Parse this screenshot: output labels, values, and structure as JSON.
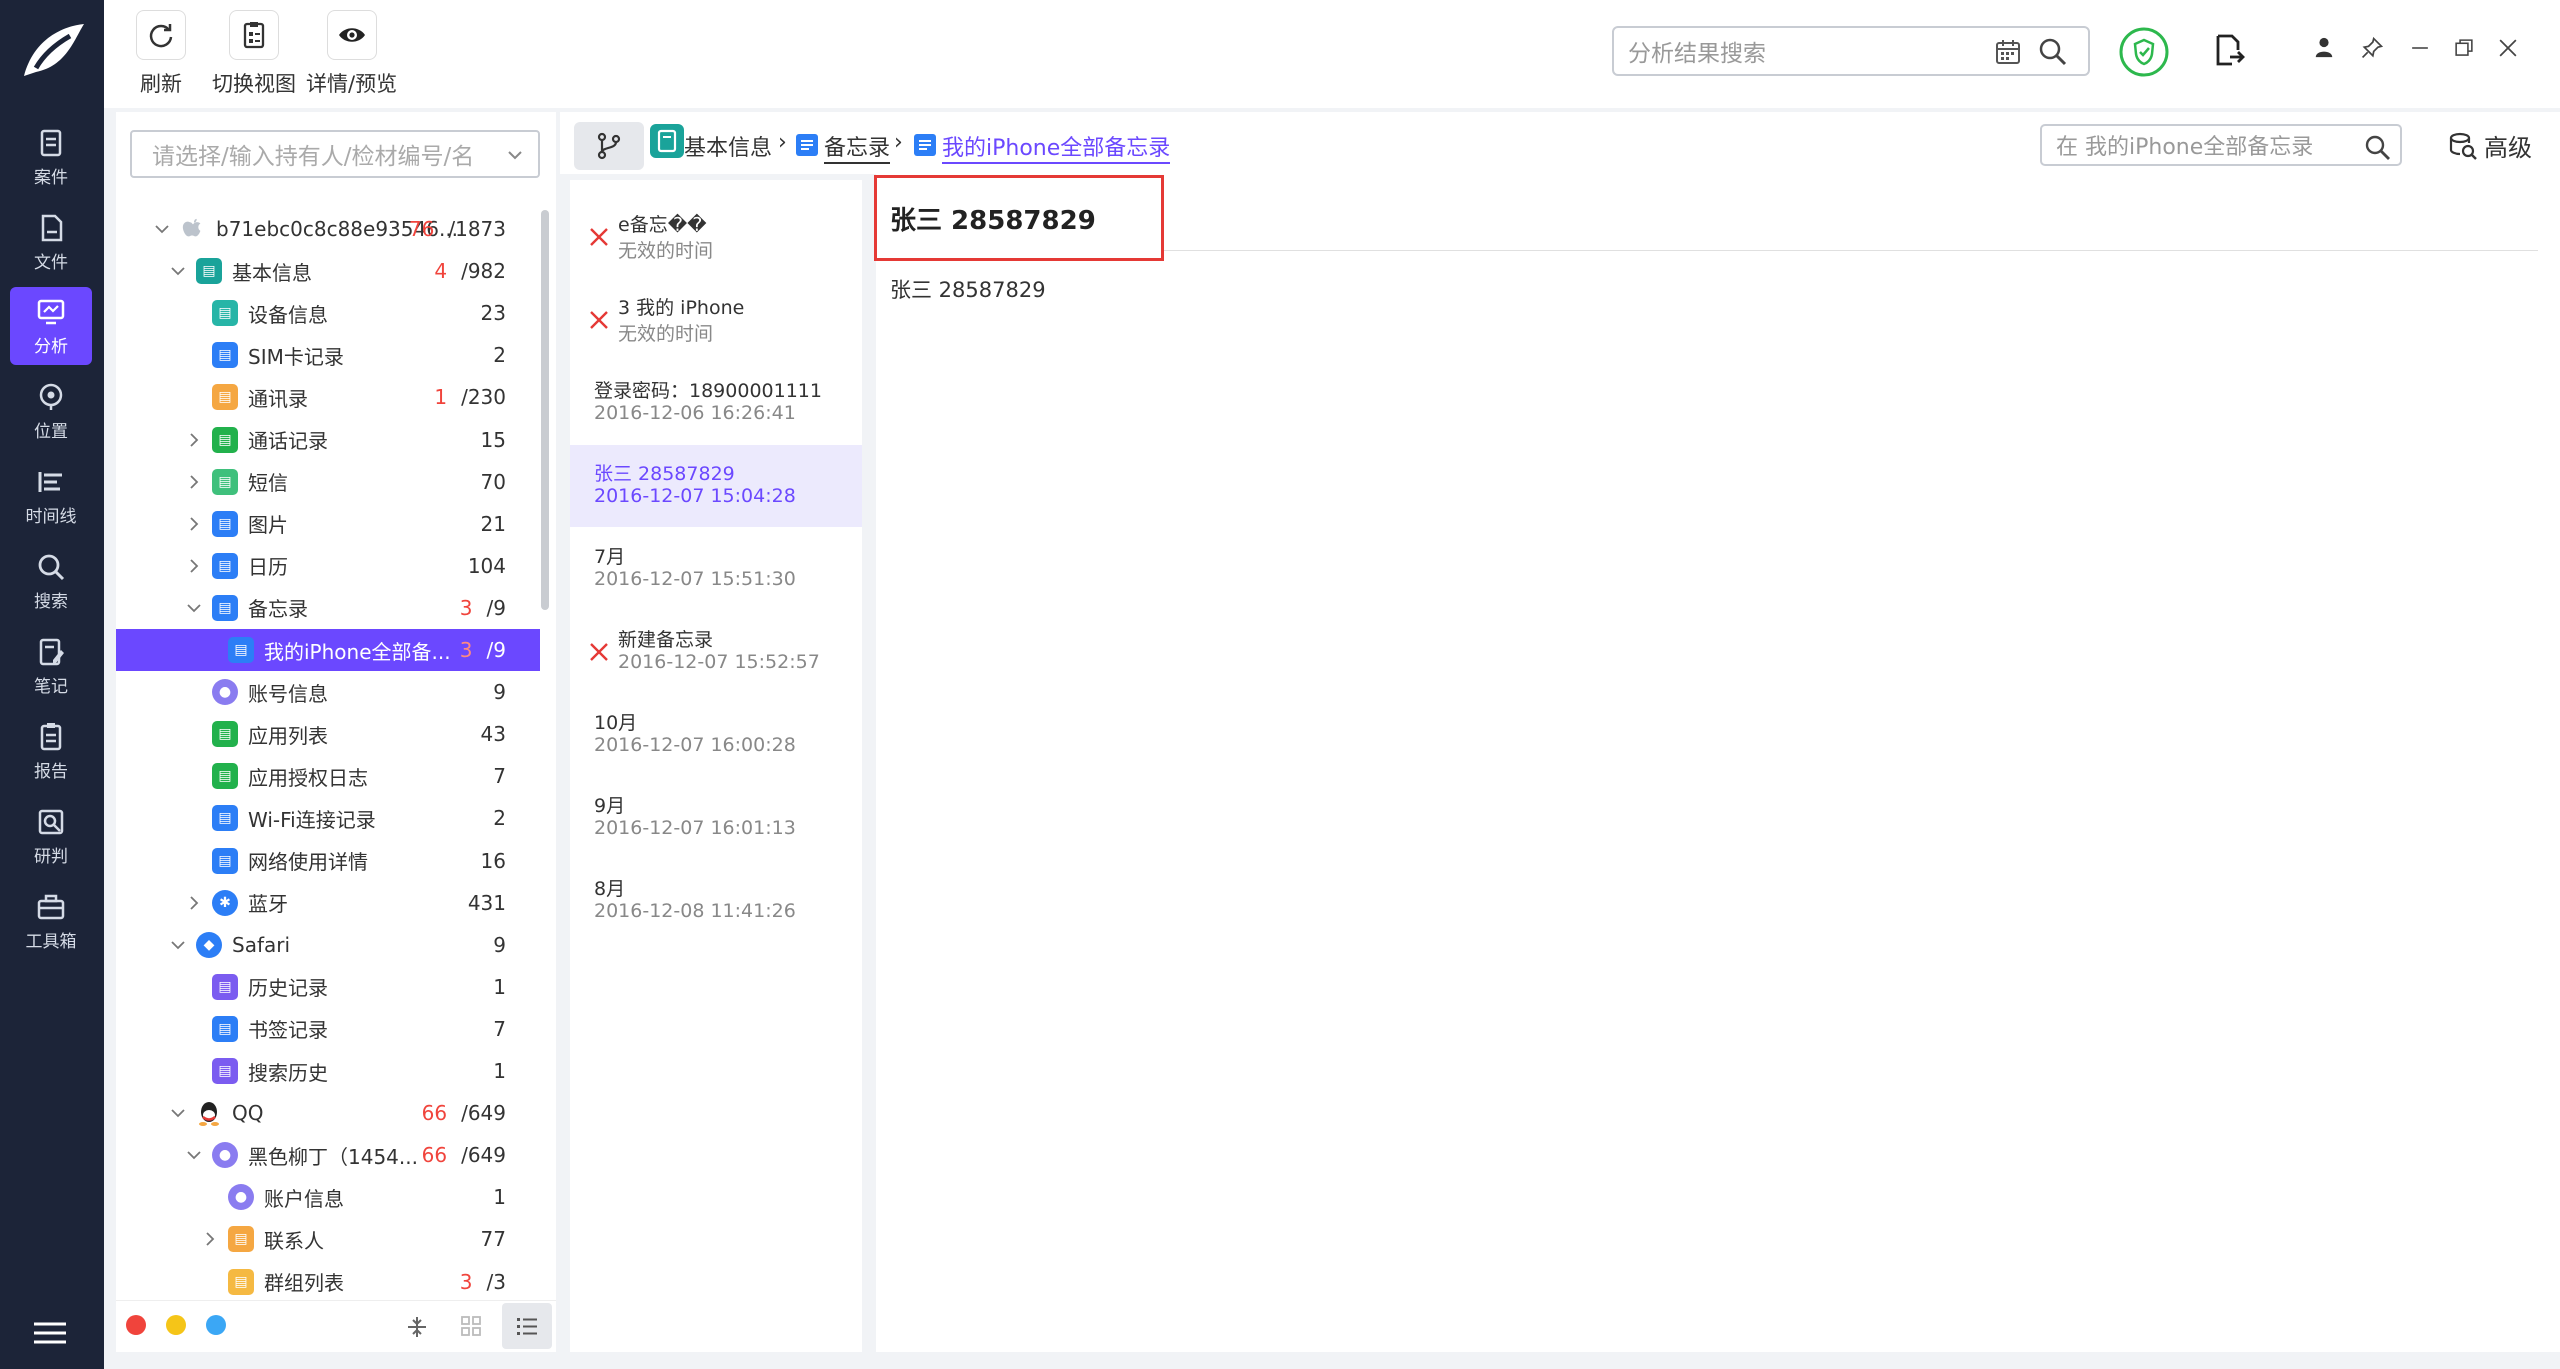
{
  "nav": {
    "items": [
      {
        "label": "案件",
        "icon": "case-icon"
      },
      {
        "label": "文件",
        "icon": "file-icon"
      },
      {
        "label": "分析",
        "icon": "analysis-icon"
      },
      {
        "label": "位置",
        "icon": "location-icon"
      },
      {
        "label": "时间线",
        "icon": "timeline-icon"
      },
      {
        "label": "搜索",
        "icon": "search-icon"
      },
      {
        "label": "笔记",
        "icon": "note-icon"
      },
      {
        "label": "报告",
        "icon": "report-icon"
      },
      {
        "label": "研判",
        "icon": "judge-icon"
      },
      {
        "label": "工具箱",
        "icon": "toolbox-icon"
      }
    ]
  },
  "toolbar": {
    "refresh_label": "刷新",
    "switch_view_label": "切换视图",
    "detail_preview_label": "详情/预览",
    "search_placeholder": "分析结果搜索"
  },
  "tree": {
    "search_placeholder": "请选择/输入持有人/检材编号/名",
    "rows": [
      {
        "label": "b71ebc0c8c88e93546...",
        "red": "76",
        "count": "/1873"
      },
      {
        "label": "基本信息",
        "red": "4",
        "count": "/982"
      },
      {
        "label": "设备信息",
        "red": "",
        "count": "23"
      },
      {
        "label": "SIM卡记录",
        "red": "",
        "count": "2"
      },
      {
        "label": "通讯录",
        "red": "1",
        "count": "/230"
      },
      {
        "label": "通话记录",
        "red": "",
        "count": "15"
      },
      {
        "label": "短信",
        "red": "",
        "count": "70"
      },
      {
        "label": "图片",
        "red": "",
        "count": "21"
      },
      {
        "label": "日历",
        "red": "",
        "count": "104"
      },
      {
        "label": "备忘录",
        "red": "3",
        "count": "/9"
      },
      {
        "label": "我的iPhone全部备...",
        "red": "3",
        "count": "/9"
      },
      {
        "label": "账号信息",
        "red": "",
        "count": "9"
      },
      {
        "label": "应用列表",
        "red": "",
        "count": "43"
      },
      {
        "label": "应用授权日志",
        "red": "",
        "count": "7"
      },
      {
        "label": "Wi-Fi连接记录",
        "red": "",
        "count": "2"
      },
      {
        "label": "网络使用详情",
        "red": "",
        "count": "16"
      },
      {
        "label": "蓝牙",
        "red": "",
        "count": "431"
      },
      {
        "label": "Safari",
        "red": "",
        "count": "9"
      },
      {
        "label": "历史记录",
        "red": "",
        "count": "1"
      },
      {
        "label": "书签记录",
        "red": "",
        "count": "7"
      },
      {
        "label": "搜索历史",
        "red": "",
        "count": "1"
      },
      {
        "label": "QQ",
        "red": "66",
        "count": "/649"
      },
      {
        "label": "黑色柳丁（1454...",
        "red": "66",
        "count": "/649"
      },
      {
        "label": "账户信息",
        "red": "",
        "count": "1"
      },
      {
        "label": "联系人",
        "red": "",
        "count": "77"
      },
      {
        "label": "群组列表",
        "red": "3",
        "count": "/3"
      }
    ]
  },
  "breadcrumb": {
    "items": [
      "基本信息",
      "备忘录",
      "我的iPhone全部备忘录"
    ],
    "search_placeholder": "在 我的iPhone全部备忘录",
    "advanced_label": "高级"
  },
  "list": {
    "items": [
      {
        "title": "e备忘��",
        "subtitle": "无效的时间",
        "error": true
      },
      {
        "title": "3 我的 iPhone",
        "subtitle": "无效的时间",
        "error": true
      },
      {
        "title": "登录密码：18900001111",
        "subtitle": "2016-12-06 16:26:41",
        "error": false
      },
      {
        "title": "张三 28587829",
        "subtitle": "2016-12-07 15:04:28",
        "error": false
      },
      {
        "title": "7月",
        "subtitle": "2016-12-07 15:51:30",
        "error": false
      },
      {
        "title": "新建备忘录",
        "subtitle": "2016-12-07 15:52:57",
        "error": true
      },
      {
        "title": "10月",
        "subtitle": "2016-12-07 16:00:28",
        "error": false
      },
      {
        "title": "9月",
        "subtitle": "2016-12-07 16:01:13",
        "error": false
      },
      {
        "title": "8月",
        "subtitle": "2016-12-08 11:41:26",
        "error": false
      }
    ]
  },
  "detail": {
    "title": "张三 28587829",
    "body": "张三 28587829"
  }
}
